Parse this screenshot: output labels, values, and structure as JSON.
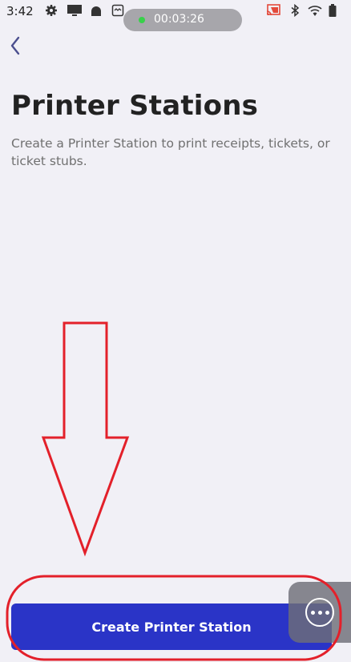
{
  "status_bar": {
    "time": "3:42",
    "recording_time": "00:03:26",
    "icons": [
      "settings-icon",
      "monitor-icon",
      "android-icon",
      "screenshot-icon",
      "cast-icon",
      "bluetooth-icon",
      "wifi-icon",
      "battery-icon"
    ]
  },
  "header": {
    "back_icon": "chevron-left-icon"
  },
  "page": {
    "title": "Printer Stations",
    "subtitle": "Create a Printer Station to print receipts, tickets, or ticket stubs."
  },
  "actions": {
    "primary_label": "Create Printer Station",
    "more_icon": "more-horizontal-icon"
  },
  "colors": {
    "background": "#f1f0f6",
    "primary": "#2a34c7",
    "annotation": "#e3202a",
    "recording_dot": "#38d14a"
  }
}
